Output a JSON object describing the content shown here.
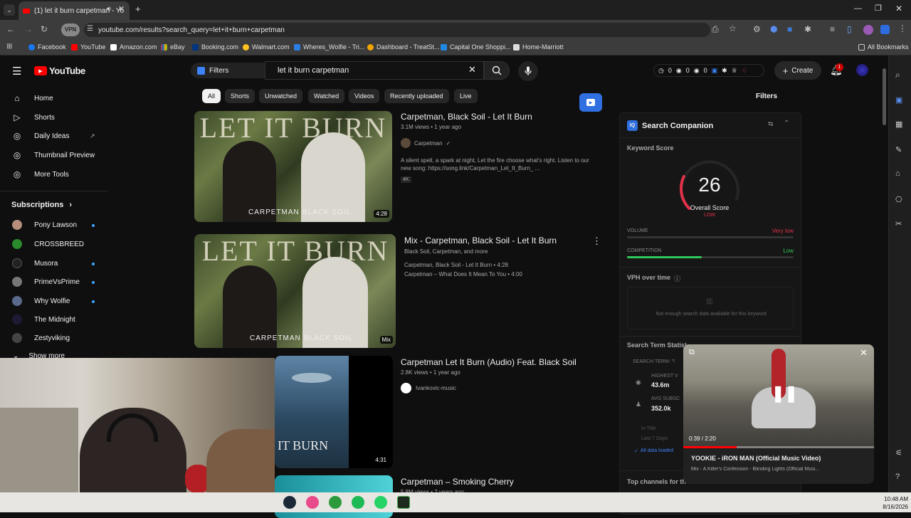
{
  "browser": {
    "tab_title": "(1) let it burn carpetman - Yo",
    "url": "youtube.com/results?search_query=let+it+burn+carpetman",
    "vpn_label": "VPN",
    "bookmarks": [
      "Facebook",
      "YouTube",
      "Amazon.com",
      "eBay",
      "Booking.com",
      "Walmart.com",
      "Wheres_Wolfie - Tri...",
      "Dashboard - TreatSt...",
      "Capital One Shoppi...",
      "Home-Marriott"
    ],
    "all_bookmarks": "All Bookmarks"
  },
  "header": {
    "logo": "YouTube",
    "filters_label": "Filters",
    "search_value": "let it burn carpetman",
    "stats": [
      "0",
      "0",
      "0"
    ],
    "create_label": "Create",
    "notif_count": "1"
  },
  "sidebar": {
    "items": [
      {
        "label": "Home",
        "icon": "home-icon"
      },
      {
        "label": "Shorts",
        "icon": "shorts-icon"
      },
      {
        "label": "Daily Ideas",
        "icon": "ideas-icon"
      },
      {
        "label": "Thumbnail Preview",
        "icon": "preview-icon"
      },
      {
        "label": "More Tools",
        "icon": "tools-icon"
      }
    ],
    "subscriptions_title": "Subscriptions",
    "subscriptions": [
      "Pony Lawson",
      "CROSSBREED",
      "Musora",
      "PrimeVsPrime",
      "Why Wolfie",
      "The Midnight",
      "Zestyviking"
    ],
    "show_more": "Show more"
  },
  "chips": [
    "All",
    "Shorts",
    "Unwatched",
    "Watched",
    "Videos",
    "Recently uploaded",
    "Live"
  ],
  "results": [
    {
      "title": "Carpetman, Black Soil - Let It Burn",
      "meta": "3.1M views • 1 year ago",
      "channel": "Carpetman",
      "desc": "A silent spell, a spark at night, Let the fire choose what's right. Listen to our new song: https://song.link/Carpetman_Let_It_Burn_ ...",
      "badge": "4K",
      "duration": "4:28"
    },
    {
      "title": "Mix - Carpetman, Black Soil - Let It Burn",
      "meta": "Black Soil, Carpetman, and more",
      "line1": "Carpetman, Black Soil - Let It Burn • 4:28",
      "line2": "Carpetman – What Does It Mean To You • 4:00",
      "duration": "Mix"
    },
    {
      "title": "Carpetman Let It Burn (Audio) Feat. Black Soil",
      "meta": "2.8K views • 1 year ago",
      "channel": "Ivankovic-music",
      "duration": "4:31"
    },
    {
      "title": "Carpetman – Smoking Cherry",
      "meta": "5.8M views • 2 years ago"
    }
  ],
  "thumb_text": {
    "title": "LET IT BURN",
    "artist1": "CARPETMAN",
    "artist2": "BLACK SOIL",
    "audio_text": "IT BURN"
  },
  "companion": {
    "panel_title": "Filters",
    "title": "Search Companion",
    "keyword_score": "Keyword Score",
    "score": "26",
    "score_label": "Overall Score",
    "score_rating": "LOW",
    "score_fraction": 0.26,
    "volume_label": "VOLUME",
    "volume_value": "Very low",
    "competition_label": "COMPETITION",
    "competition_value": "Low",
    "competition_fraction": 0.45,
    "vph_title": "VPH over time",
    "vph_empty": "Not enough search data available for this keyword",
    "stats_title": "Search Term Statist",
    "search_term": "SEARCH TERM: \"l",
    "highest_label": "HIGHEST V",
    "highest_value": "43.6m",
    "avg_label": "AVG SUBSC",
    "avg_value": "352.0k",
    "in_title": "In Title",
    "last7": "Last 7 Days",
    "all_loaded": "All data loaded",
    "top_channels": "Top channels for th"
  },
  "mini_player": {
    "time": "0:39 / 2:20",
    "progress": 0.28,
    "title": "YOOKIE - iRON MAN (Official Music Video)",
    "subtitle": "Mix - A Killer's Confession - Blinding Lights (Official Musi..."
  },
  "taskbar": {
    "time": "10:48 AM",
    "date": "8/16/2026"
  }
}
